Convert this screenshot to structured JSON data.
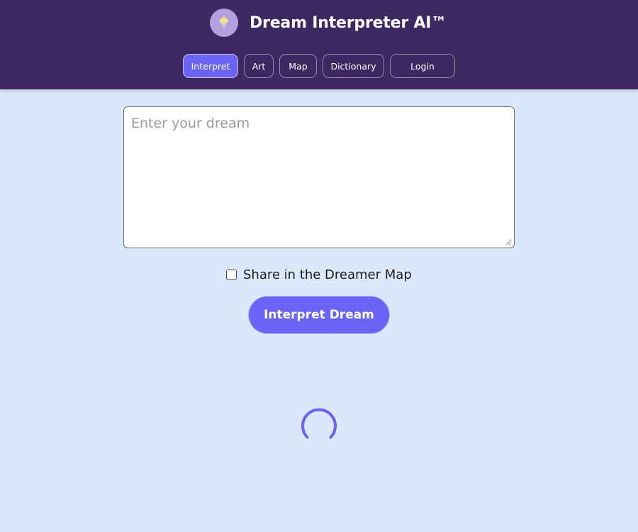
{
  "header": {
    "title": "Dream Interpreter AI™",
    "logo_icon": "crystal-gem-icon",
    "background_color": "#3e2862",
    "logo_color": "#b3a0de"
  },
  "nav": {
    "items": [
      {
        "label": "Interpret",
        "active": true
      },
      {
        "label": "Art",
        "active": false
      },
      {
        "label": "Map",
        "active": false
      },
      {
        "label": "Dictionary",
        "active": false
      },
      {
        "label": "Login",
        "active": false
      }
    ],
    "active_color": "#6a63f6"
  },
  "dream_input": {
    "placeholder": "Enter your dream",
    "value": ""
  },
  "share": {
    "label": "Share in the Dreamer Map",
    "checked": false
  },
  "interpret_button": {
    "label": "Interpret Dream",
    "color": "#6a63f6"
  },
  "loading": {
    "spinner_icon": "loading-spinner-icon",
    "color": "#6a63f6"
  },
  "page": {
    "background_color": "#dbe8fc"
  }
}
